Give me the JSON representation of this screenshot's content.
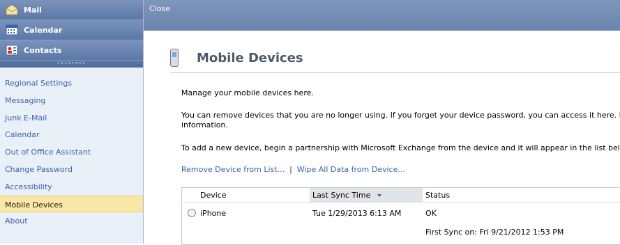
{
  "nav": {
    "buttons": [
      {
        "label": "Mail",
        "icon": "mail-icon"
      },
      {
        "label": "Calendar",
        "icon": "calendar-icon"
      },
      {
        "label": "Contacts",
        "icon": "contacts-icon"
      }
    ],
    "options": [
      {
        "label": "Regional Settings"
      },
      {
        "label": "Messaging"
      },
      {
        "label": "Junk E-Mail"
      },
      {
        "label": "Calendar"
      },
      {
        "label": "Out of Office Assistant"
      },
      {
        "label": "Change Password"
      },
      {
        "label": "Accessibility"
      },
      {
        "label": "Mobile Devices",
        "selected": true
      },
      {
        "label": "About"
      }
    ]
  },
  "toolbar": {
    "close_label": "Close"
  },
  "page": {
    "title": "Mobile Devices",
    "intro": "Manage your mobile devices here.",
    "remove_text_line1": "You can remove devices that you are no longer using. If you forget your device password, you can access it here. If you l",
    "remove_text_line2": "information.",
    "add_text": "To add a new device, begin a partnership with Microsoft Exchange from the device and it will appear in the list below.",
    "remove_link": "Remove Device from List...",
    "separator": "|",
    "wipe_link": "Wipe All Data from Device..."
  },
  "table": {
    "columns": [
      "Device",
      "Last Sync Time",
      "Status"
    ],
    "sorted_column": "Last Sync Time",
    "rows": [
      {
        "device": "iPhone",
        "last_sync": "Tue 1/29/2013 6:13 AM",
        "status": "OK",
        "first_sync": "First Sync on: Fri 9/21/2012 1:53 PM"
      }
    ]
  },
  "colors": {
    "accent": "#6a84ad",
    "link": "#3b63a8",
    "selected": "#fbe7a5"
  }
}
